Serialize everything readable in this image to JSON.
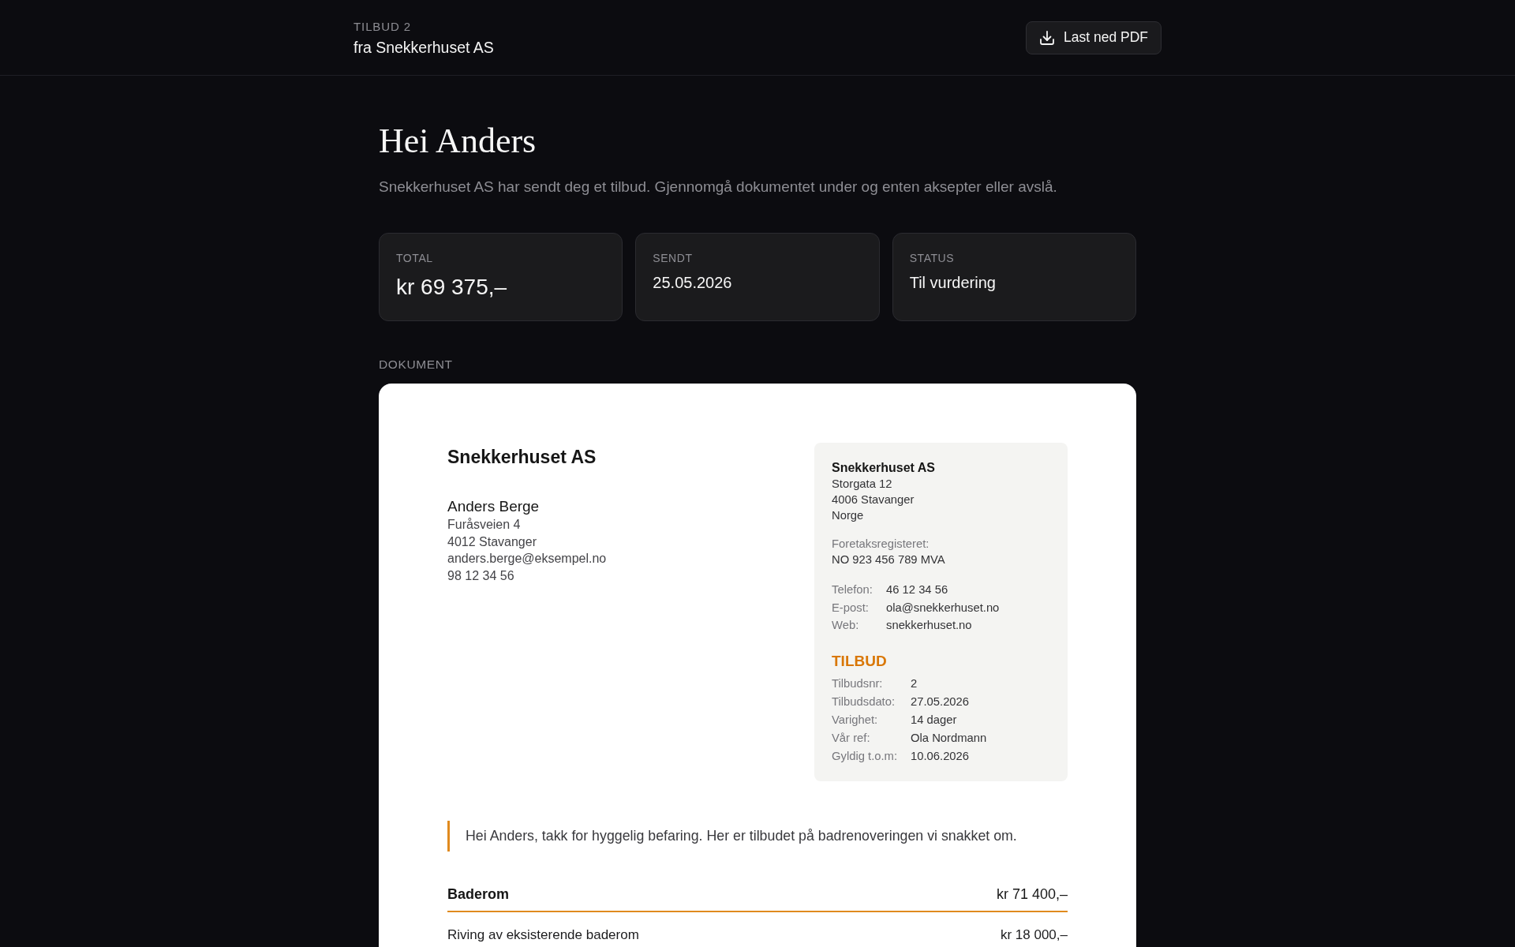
{
  "header": {
    "eyebrow": "TILBUD 2",
    "title": "fra Snekkerhuset AS",
    "download_button": "Last ned PDF"
  },
  "greeting": {
    "heading": "Hei Anders",
    "intro": "Snekkerhuset AS har sendt deg et tilbud. Gjennomgå dokumentet under og enten aksepter eller avslå."
  },
  "summary_cards": [
    {
      "label": "TOTAL",
      "value": "kr 69 375,–",
      "kind": "amount"
    },
    {
      "label": "SENDT",
      "value": "25.05.2026",
      "kind": "text"
    },
    {
      "label": "STATUS",
      "value": "Til vurdering",
      "kind": "text"
    }
  ],
  "document_section": {
    "label": "DOKUMENT",
    "document": {
      "company_name": "Snekkerhuset AS",
      "recipient": {
        "name": "Anders Berge",
        "lines": [
          "Furåsveien 4",
          "4012 Stavanger",
          "anders.berge@eksempel.no",
          "98 12 34 56"
        ]
      },
      "company_box": {
        "name": "Snekkerhuset AS",
        "address_lines": [
          "Storgata 12",
          "4006 Stavanger",
          "Norge"
        ],
        "registry_label": "Foretaksregisteret:",
        "registry_value": "NO 923 456 789 MVA",
        "contacts": [
          {
            "label": "Telefon:",
            "value": "46 12 34 56"
          },
          {
            "label": "E-post:",
            "value": "ola@snekkerhuset.no"
          },
          {
            "label": "Web:",
            "value": "snekkerhuset.no"
          }
        ],
        "offer_title": "TILBUD",
        "offer_details": [
          {
            "label": "Tilbudsnr:",
            "value": "2"
          },
          {
            "label": "Tilbudsdato:",
            "value": "27.05.2026"
          },
          {
            "label": "Varighet:",
            "value": "14 dager"
          },
          {
            "label": "Vår ref:",
            "value": "Ola Nordmann"
          },
          {
            "label": "Gyldig t.o.m:",
            "value": "10.06.2026"
          }
        ]
      },
      "note": "Hei Anders, takk for hyggelig befaring. Her er tilbudet på badrenoveringen vi snakket om.",
      "sections": [
        {
          "title": "Baderom",
          "amount": "kr 71 400,–",
          "lines": [
            {
              "description": "Riving av eksisterende baderom",
              "amount": "kr 18 000,–"
            }
          ]
        }
      ]
    }
  }
}
